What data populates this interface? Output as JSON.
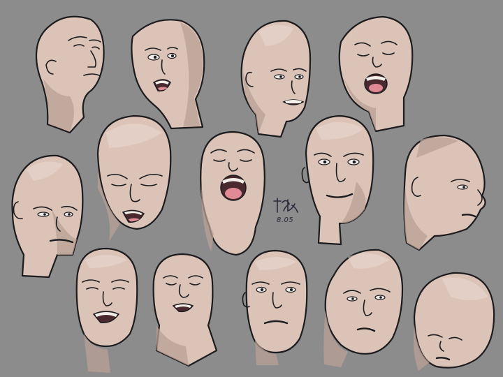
{
  "artwork": {
    "background_color": "#8c8c8c",
    "skin_color": "#dcc3b8",
    "shadow_color": "#b9a096",
    "line_color": "#1c1b1d",
    "mouth_color": "#e08a96",
    "head_count": 14
  },
  "signature": {
    "date_text": "8.05"
  }
}
